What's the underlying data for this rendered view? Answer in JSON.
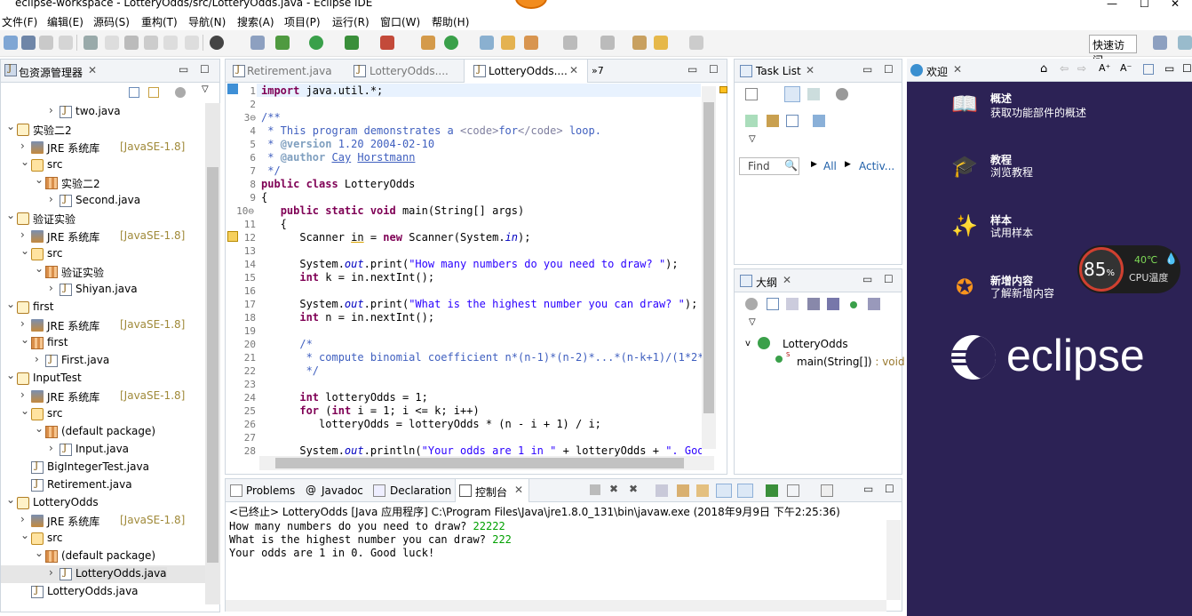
{
  "window": {
    "title": "eclipse-workspace - LotteryOdds/src/LotteryOdds.java - Eclipse IDE",
    "min": "—",
    "max": "☐",
    "close": "✕"
  },
  "menu": [
    "文件(F)",
    "编辑(E)",
    "源码(S)",
    "重构(T)",
    "导航(N)",
    "搜索(A)",
    "项目(P)",
    "运行(R)",
    "窗口(W)",
    "帮助(H)"
  ],
  "toolbar": {
    "quick_access": "快速访问"
  },
  "explorer": {
    "title": "包资源管理器",
    "items": [
      {
        "indent": 3,
        "arrow": ">",
        "icon": "java",
        "text": "two.java"
      },
      {
        "indent": 0,
        "arrow": "v",
        "icon": "proj",
        "text": "实验二2"
      },
      {
        "indent": 1,
        "arrow": ">",
        "icon": "lib",
        "text": "JRE 系统库",
        "dim": "[JavaSE-1.8]"
      },
      {
        "indent": 1,
        "arrow": "v",
        "icon": "src",
        "text": "src"
      },
      {
        "indent": 2,
        "arrow": "v",
        "icon": "pkg",
        "text": "实验二2"
      },
      {
        "indent": 3,
        "arrow": ">",
        "icon": "java",
        "text": "Second.java"
      },
      {
        "indent": 0,
        "arrow": "v",
        "icon": "proj",
        "text": "验证实验"
      },
      {
        "indent": 1,
        "arrow": ">",
        "icon": "lib",
        "text": "JRE 系统库",
        "dim": "[JavaSE-1.8]"
      },
      {
        "indent": 1,
        "arrow": "v",
        "icon": "src",
        "text": "src"
      },
      {
        "indent": 2,
        "arrow": "v",
        "icon": "pkg",
        "text": "验证实验"
      },
      {
        "indent": 3,
        "arrow": ">",
        "icon": "java",
        "text": "Shiyan.java"
      },
      {
        "indent": 0,
        "arrow": "v",
        "icon": "proj",
        "text": "first"
      },
      {
        "indent": 1,
        "arrow": ">",
        "icon": "lib",
        "text": "JRE 系统库",
        "dim": "[JavaSE-1.8]"
      },
      {
        "indent": 1,
        "arrow": "v",
        "icon": "pkg",
        "text": "first"
      },
      {
        "indent": 2,
        "arrow": ">",
        "icon": "java",
        "text": "First.java"
      },
      {
        "indent": 0,
        "arrow": "v",
        "icon": "proj",
        "text": "InputTest"
      },
      {
        "indent": 1,
        "arrow": ">",
        "icon": "lib",
        "text": "JRE 系统库",
        "dim": "[JavaSE-1.8]"
      },
      {
        "indent": 1,
        "arrow": "v",
        "icon": "src",
        "text": "src"
      },
      {
        "indent": 2,
        "arrow": "v",
        "icon": "pkg",
        "text": "(default package)"
      },
      {
        "indent": 3,
        "arrow": ">",
        "icon": "java",
        "text": "Input.java"
      },
      {
        "indent": 1,
        "arrow": "",
        "icon": "java",
        "text": "BigIntegerTest.java"
      },
      {
        "indent": 1,
        "arrow": "",
        "icon": "java",
        "text": "Retirement.java"
      },
      {
        "indent": 0,
        "arrow": "v",
        "icon": "proj",
        "text": "LotteryOdds"
      },
      {
        "indent": 1,
        "arrow": ">",
        "icon": "lib",
        "text": "JRE 系统库",
        "dim": "[JavaSE-1.8]"
      },
      {
        "indent": 1,
        "arrow": "v",
        "icon": "src",
        "text": "src"
      },
      {
        "indent": 2,
        "arrow": "v",
        "icon": "pkg",
        "text": "(default package)"
      },
      {
        "indent": 3,
        "arrow": ">",
        "icon": "java",
        "text": "LotteryOdds.java",
        "selected": true
      },
      {
        "indent": 1,
        "arrow": "",
        "icon": "java",
        "text": "LotteryOdds.java"
      }
    ]
  },
  "editor": {
    "tabs": [
      "Retirement.java",
      "LotteryOdds....",
      "LotteryOdds....",
      "»7"
    ],
    "lines": [
      "1",
      "2",
      "3⊖",
      "4",
      "5",
      "6",
      "7",
      "8",
      "9",
      "10⊖",
      "11",
      "12",
      "13",
      "14",
      "15",
      "16",
      "17",
      "18",
      "19",
      "20",
      "21",
      "22",
      "23",
      "24",
      "25",
      "26",
      "27",
      "28"
    ]
  },
  "tasklist": {
    "title": "Task List",
    "find": "Find",
    "all": "All",
    "activ": "Activ..."
  },
  "outline": {
    "title": "大纲",
    "class": "LotteryOdds",
    "method": "main(String[])",
    "ret": " : void"
  },
  "bottom": {
    "tabs": [
      "Problems",
      "Javadoc",
      "Declaration",
      "控制台"
    ],
    "status": "<已终止> LotteryOdds [Java 应用程序] C:\\Program Files\\Java\\jre1.8.0_131\\bin\\javaw.exe  (2018年9月9日 下午2:25:36)",
    "lines": [
      {
        "p": "How many numbers do you need to draw? ",
        "i": "22222"
      },
      {
        "p": "What is the highest number you can draw? ",
        "i": "222"
      },
      {
        "p": "Your odds are 1 in 0. Good luck!",
        "i": ""
      }
    ]
  },
  "welcome": {
    "title": "欢迎",
    "items": [
      {
        "t": "概述",
        "s": "获取功能部件的概述"
      },
      {
        "t": "教程",
        "s": "浏览教程"
      },
      {
        "t": "样本",
        "s": "试用样本"
      },
      {
        "t": "新增内容",
        "s": "了解新增内容"
      }
    ],
    "brand": "eclipse",
    "cpu_pct": "85",
    "pct_sign": "%",
    "temp": "40℃",
    "cpu_label": "CPU温度"
  }
}
